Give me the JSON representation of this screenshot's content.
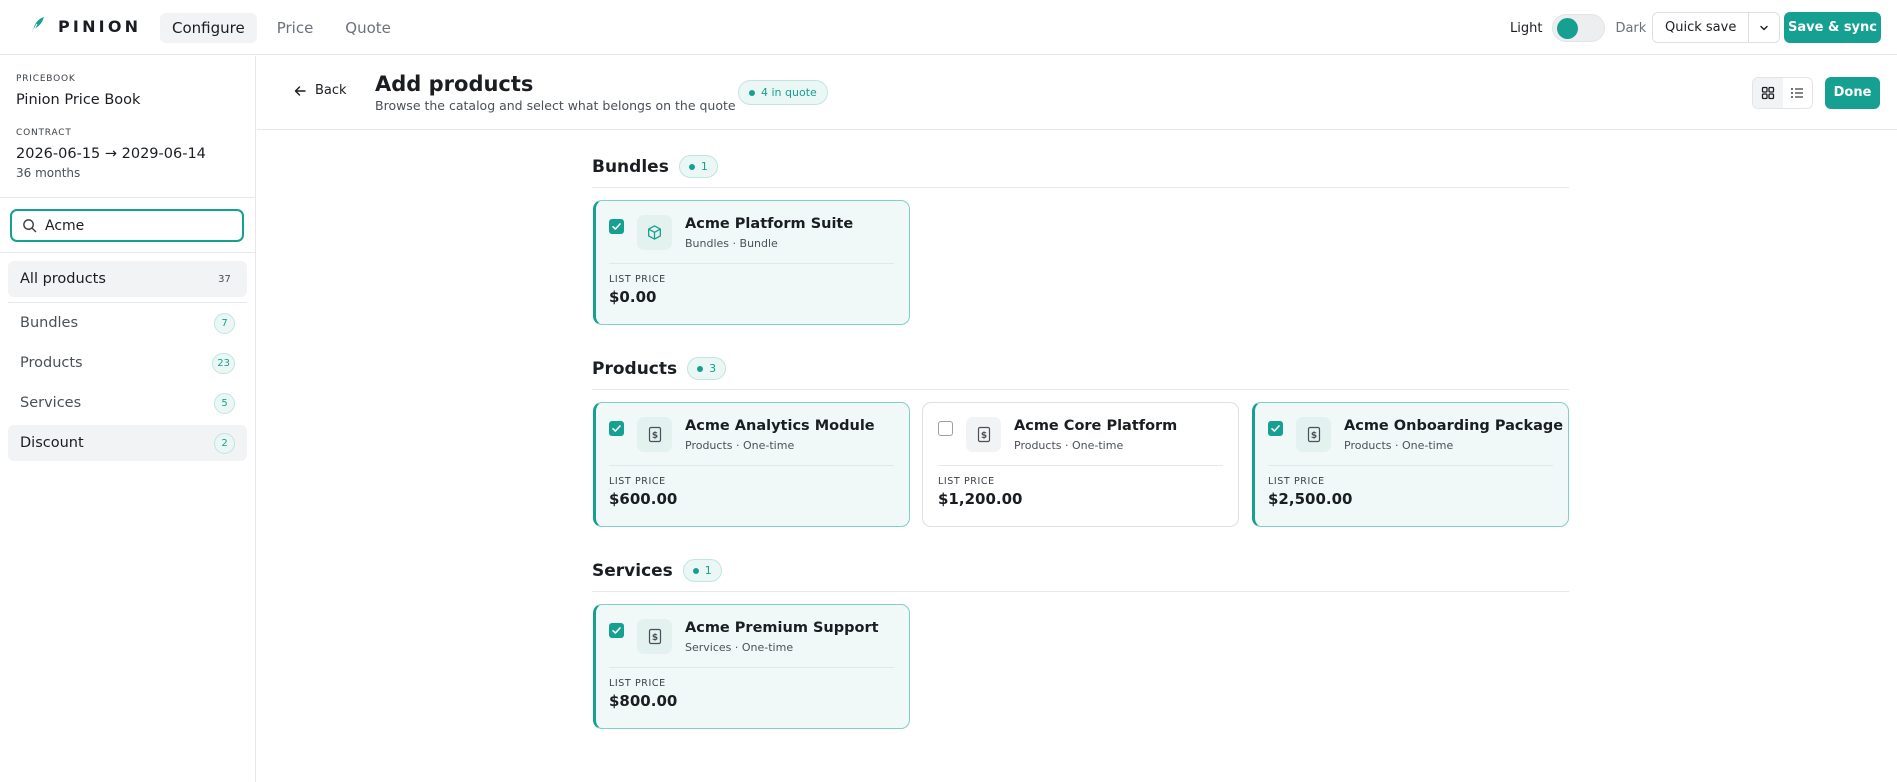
{
  "app": {
    "brand": "PINION"
  },
  "nav": {
    "tabs": [
      "Configure",
      "Price",
      "Quote"
    ],
    "active": "Configure"
  },
  "theme": {
    "light_label": "Light",
    "dark_label": "Dark"
  },
  "actions": {
    "quick_save": "Quick save",
    "save_sync": "Save & sync",
    "done": "Done",
    "back": "Back"
  },
  "sidebar": {
    "pricebook_label": "PRICEBOOK",
    "pricebook_value": "Pinion Price Book",
    "contract_label": "CONTRACT",
    "contract_value": "2026-06-15 → 2029-06-14",
    "contract_term": "36 months",
    "search_value": "Acme",
    "categories": [
      {
        "label": "All products",
        "count": "37"
      },
      {
        "label": "Bundles",
        "count": "7"
      },
      {
        "label": "Products",
        "count": "23"
      },
      {
        "label": "Services",
        "count": "5"
      },
      {
        "label": "Discount",
        "count": "2"
      }
    ]
  },
  "header": {
    "title": "Add products",
    "subtitle": "Browse the catalog and select what belongs on the quote",
    "quote_count": "4 in quote"
  },
  "sections": [
    {
      "title": "Bundles",
      "badge": "1",
      "items": [
        {
          "name": "Acme Platform Suite",
          "meta": "Bundles · Bundle",
          "price_label": "LIST PRICE",
          "price": "$0.00",
          "selected": true,
          "icon": "box-icon"
        }
      ]
    },
    {
      "title": "Products",
      "badge": "3",
      "items": [
        {
          "name": "Acme Analytics Module",
          "meta": "Products · One-time",
          "price_label": "LIST PRICE",
          "price": "$600.00",
          "selected": true,
          "icon": "dollar-doc-icon"
        },
        {
          "name": "Acme Core Platform",
          "meta": "Products · One-time",
          "price_label": "LIST PRICE",
          "price": "$1,200.00",
          "selected": false,
          "icon": "dollar-doc-icon"
        },
        {
          "name": "Acme Onboarding Package",
          "meta": "Products · One-time",
          "price_label": "LIST PRICE",
          "price": "$2,500.00",
          "selected": true,
          "icon": "dollar-doc-icon"
        }
      ]
    },
    {
      "title": "Services",
      "badge": "1",
      "items": [
        {
          "name": "Acme Premium Support",
          "meta": "Services · One-time",
          "price_label": "LIST PRICE",
          "price": "$800.00",
          "selected": true,
          "icon": "dollar-doc-icon"
        }
      ]
    }
  ],
  "colors": {
    "accent": "#15a092",
    "accent_soft": "#eaf7f5",
    "selected_card_bg": "#f1f9f8",
    "border": "#e6e8eb"
  }
}
